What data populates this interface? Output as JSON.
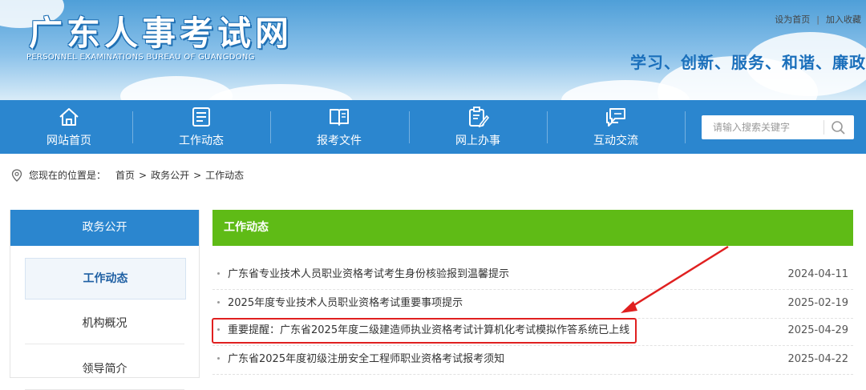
{
  "header": {
    "site_title": "广东人事考试网",
    "site_subtitle": "PERSONNEL EXAMINATIONS BUREAU OF GUANGDONG",
    "top_links": [
      "设为首页",
      "加入收藏"
    ],
    "top_link_separator": "|",
    "slogan": "学习、创新、服务、和谐、廉政"
  },
  "nav": {
    "items": [
      {
        "label": "网站首页",
        "icon": "home-icon"
      },
      {
        "label": "工作动态",
        "icon": "news-list-icon"
      },
      {
        "label": "报考文件",
        "icon": "book-icon"
      },
      {
        "label": "网上办事",
        "icon": "clipboard-edit-icon"
      },
      {
        "label": "互动交流",
        "icon": "chat-bubbles-icon"
      }
    ],
    "search": {
      "placeholder": "请输入搜索关键字",
      "value": "",
      "icon": "search-icon"
    }
  },
  "breadcrumb": {
    "icon": "location-pin-icon",
    "prefix": "您现在的位置是：",
    "crumbs": [
      "首页",
      "政务公开",
      "工作动态"
    ],
    "separator": ">"
  },
  "sidebar": {
    "heading": "政务公开",
    "items": [
      {
        "label": "工作动态",
        "active": true
      },
      {
        "label": "机构概况",
        "active": false
      },
      {
        "label": "领导简介",
        "active": false
      }
    ]
  },
  "content": {
    "heading": "工作动态",
    "articles": [
      {
        "title": "广东省专业技术人员职业资格考试考生身份核验报到温馨提示",
        "date": "2024-04-11"
      },
      {
        "title": "2025年度专业技术人员职业资格考试重要事项提示",
        "date": "2025-02-19"
      },
      {
        "title": "重要提醒：广东省2025年度二级建造师执业资格考试计算机化考试模拟作答系统已上线",
        "date": "2025-04-29",
        "highlighted": true
      },
      {
        "title": "广东省2025年度初级注册安全工程师职业资格考试报考须知",
        "date": "2025-04-22"
      }
    ]
  },
  "colors": {
    "nav_blue": "#2b86cf",
    "content_header_green": "#5fbb16",
    "annotation_red": "#e02020",
    "slogan_blue": "#1a6fbb"
  }
}
